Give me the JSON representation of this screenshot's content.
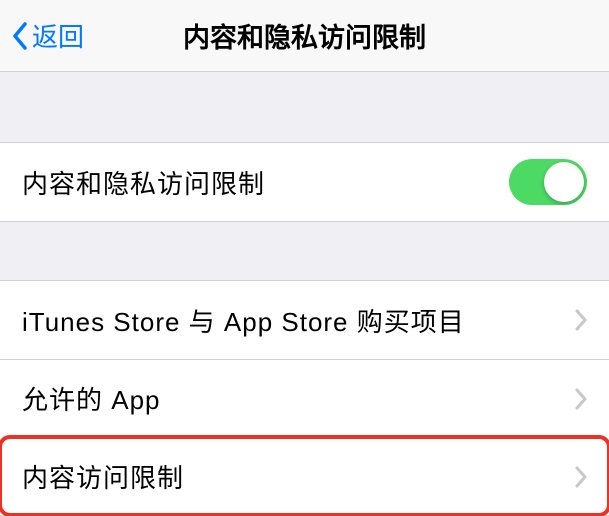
{
  "header": {
    "back_label": "返回",
    "title": "内容和隐私访问限制"
  },
  "toggle_row": {
    "label": "内容和隐私访问限制",
    "enabled": true
  },
  "menu": {
    "items": [
      {
        "label": "iTunes Store 与 App Store 购买项目"
      },
      {
        "label": "允许的 App"
      },
      {
        "label": "内容访问限制"
      }
    ]
  }
}
